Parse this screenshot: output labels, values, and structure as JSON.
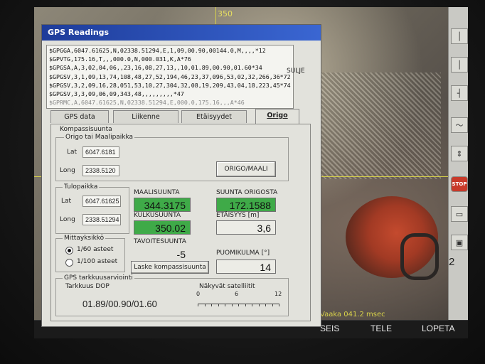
{
  "camera": {
    "heading": "350",
    "info": "Vaaka 041.2 msec"
  },
  "dialog": {
    "title": "GPS Readings",
    "nmea_lines": [
      "$GPGGA,6047.61625,N,02338.51294,E,1,09,00.90,00144.0,M,,,,*12",
      "$GPVTG,175.16,T,,,000.0,N,000.031,K,A*76",
      "$GPGSA,A,3,02,04,06,,23,16,08,27,13,,10,01.89,00.90,01.60*34",
      "$GPGSV,3,1,09,13,74,108,48,27,52,194,46,23,37,096,53,02,32,266,36*72",
      "$GPGSV,3,2,09,16,28,051,53,10,27,304,32,08,19,209,43,04,18,223,45*74",
      "$GPGSV,3,3,09,06,09,343,48,,,,,,,,,*47",
      "$GPRMC,A,6047.61625,N,02338.51294,E,000.0,175.16,,,A*46"
    ],
    "close_label": "SULJE",
    "tabs": [
      "GPS data",
      "Liikenne",
      "Etäisyydet",
      "Origo"
    ],
    "active_tab": "Origo",
    "kompassi_label": "Kompassisuunta",
    "origo": {
      "group_label": "Origo tai Maalipaikka",
      "lat_label": "Lat",
      "lat_value": "6047.6181",
      "long_label": "Long",
      "long_value": "2338.5120",
      "button": "ORIGO/MAALI"
    },
    "tulopaikka": {
      "group_label": "Tulopaikka",
      "lat_label": "Lat",
      "lat_value": "6047.61625",
      "long_label": "Long",
      "long_value": "2338.51294"
    },
    "readouts": {
      "maalisuunta_label": "MAALISUUNTA",
      "maalisuunta_value": "344.3175",
      "suunta_origosta_label": "SUUNTA ORIGOSTA",
      "suunta_origosta_value": "172.1588",
      "kulkusuunta_label": "KULKUSUUNTA",
      "kulkusuunta_value": "350.02",
      "etaisyys_label": "ETÄISYYS [m]",
      "etaisyys_value": "3,6",
      "tavoitesuunta_label": "TAVOITESUUNTA",
      "tavoitesuunta_value": "-5",
      "puomikulma_label": "PUOMIKULMA [°]",
      "puomikulma_value": "14",
      "laske_button": "Laske kompassisuunta"
    },
    "mittayksikko": {
      "group_label": "Mittayksikkö",
      "option1": "1/60 asteet",
      "option2": "1/100 asteet",
      "selected": "1/60 asteet"
    },
    "gps_tarkkuus": {
      "group_label": "GPS tarkkuusarviointi",
      "dop_label": "Tarkkuus DOP",
      "dop_value": "01.89/00.90/01.60",
      "sat_label": "Näkyvät satelliitit",
      "scale_min": "0",
      "scale_mid": "6",
      "scale_max": "12"
    }
  },
  "bottom_bar": {
    "seis": "SEIS",
    "tele": "TELE",
    "lopeta": "LOPETA"
  },
  "right_toolbar": {
    "stop_label": "STOP",
    "number": "2"
  }
}
